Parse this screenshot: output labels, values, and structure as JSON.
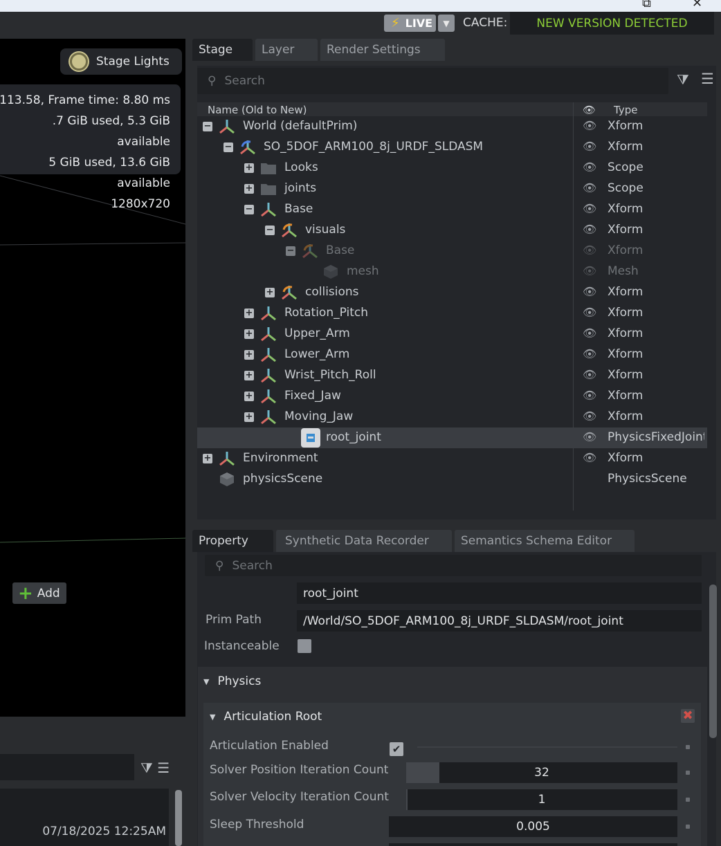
{
  "topbar": {
    "live_label": "LIVE",
    "cache_label": "CACHE:",
    "cache_status": "NEW VERSION DETECTED",
    "accent_live_bolt": "#f2c623",
    "accent_status": "#8ed037"
  },
  "viewport": {
    "lights_label": "Stage Lights",
    "stats": [
      "113.58, Frame time: 8.80 ms",
      ".7 GiB used, 5.3 GiB available",
      "5 GiB used, 13.6 GiB available",
      "1280x720"
    ],
    "timestamp": "07/18/2025 12:25AM"
  },
  "stage": {
    "tabs": [
      "Stage",
      "Layer",
      "Render Settings"
    ],
    "search_placeholder": "Search",
    "col_name": "Name (Old to New)",
    "col_type": "Type",
    "rows": [
      {
        "label": "World (defaultPrim)",
        "type": "Xform",
        "depth": 0,
        "exp": "−",
        "icon": "xform-icon"
      },
      {
        "label": "SO_5DOF_ARM100_8j_URDF_SLDASM",
        "type": "Xform",
        "depth": 1,
        "exp": "−",
        "icon": "instance-xform-icon"
      },
      {
        "label": "Looks",
        "type": "Scope",
        "depth": 2,
        "exp": "+",
        "icon": "folder-icon"
      },
      {
        "label": "joints",
        "type": "Scope",
        "depth": 2,
        "exp": "+",
        "icon": "folder-icon"
      },
      {
        "label": "Base",
        "type": "Xform",
        "depth": 2,
        "exp": "−",
        "icon": "xform-icon"
      },
      {
        "label": "visuals",
        "type": "Xform",
        "depth": 3,
        "exp": "−",
        "icon": "reference-xform-icon"
      },
      {
        "label": "Base",
        "type": "Xform",
        "depth": 4,
        "exp": "−",
        "icon": "reference-xform-icon",
        "dim": true
      },
      {
        "label": "mesh",
        "type": "Mesh",
        "depth": 5,
        "exp": "",
        "icon": "mesh-icon",
        "dim": true
      },
      {
        "label": "collisions",
        "type": "Xform",
        "depth": 3,
        "exp": "+",
        "icon": "reference-xform-icon"
      },
      {
        "label": "Rotation_Pitch",
        "type": "Xform",
        "depth": 2,
        "exp": "+",
        "icon": "xform-icon"
      },
      {
        "label": "Upper_Arm",
        "type": "Xform",
        "depth": 2,
        "exp": "+",
        "icon": "xform-icon"
      },
      {
        "label": "Lower_Arm",
        "type": "Xform",
        "depth": 2,
        "exp": "+",
        "icon": "xform-icon"
      },
      {
        "label": "Wrist_Pitch_Roll",
        "type": "Xform",
        "depth": 2,
        "exp": "+",
        "icon": "xform-icon"
      },
      {
        "label": "Fixed_Jaw",
        "type": "Xform",
        "depth": 2,
        "exp": "+",
        "icon": "xform-icon"
      },
      {
        "label": "Moving_Jaw",
        "type": "Xform",
        "depth": 2,
        "exp": "+",
        "icon": "xform-icon"
      },
      {
        "label": "root_joint",
        "type": "PhysicsFixedJoint",
        "depth": 2,
        "exp": "",
        "icon": "joint-icon",
        "selected": true
      },
      {
        "label": "Environment",
        "type": "Xform",
        "depth": 0,
        "exp": "+",
        "icon": "xform-icon"
      },
      {
        "label": "physicsScene",
        "type": "PhysicsScene",
        "depth": 0,
        "exp": "",
        "icon": "mesh-icon",
        "noeye": true
      }
    ]
  },
  "property": {
    "tabs": [
      "Property",
      "Synthetic Data Recorder",
      "Semantics Schema Editor"
    ],
    "search_placeholder": "Search",
    "add_label": "Add",
    "name_value": "root_joint",
    "prim_path_label": "Prim Path",
    "prim_path_value": "/World/SO_5DOF_ARM100_8j_URDF_SLDASM/root_joint",
    "instanceable_label": "Instanceable",
    "physics_label": "Physics",
    "articulation_root_label": "Articulation Root",
    "articulation_enabled_label": "Articulation Enabled",
    "articulation_enabled": true,
    "solver_pos_label": "Solver Position Iteration Count",
    "solver_pos_value": "32",
    "solver_vel_label": "Solver Velocity Iteration Count",
    "solver_vel_value": "1",
    "sleep_label": "Sleep Threshold",
    "sleep_value": "0.005"
  }
}
